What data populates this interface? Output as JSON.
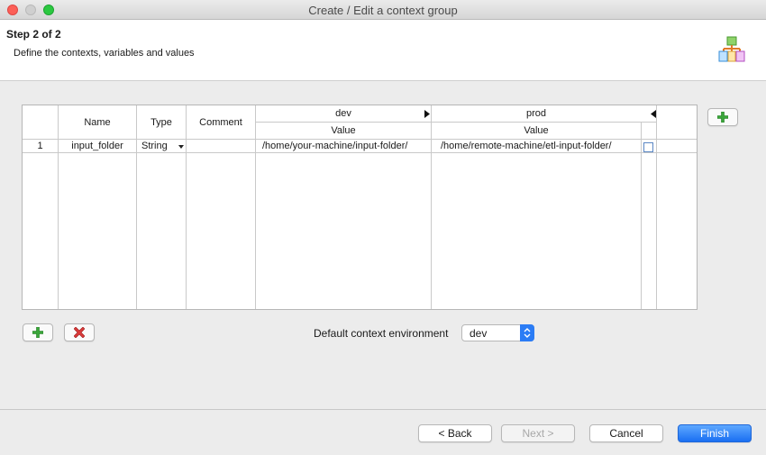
{
  "window": {
    "title": "Create / Edit a context group"
  },
  "header": {
    "step": "Step 2 of 2",
    "description": "Define the contexts, variables and values",
    "icon": "context-group-wizard-icon"
  },
  "table": {
    "columns": {
      "name": "Name",
      "type": "Type",
      "comment": "Comment"
    },
    "contexts": [
      {
        "name": "dev",
        "value_header": "Value"
      },
      {
        "name": "prod",
        "value_header": "Value"
      }
    ],
    "rows": [
      {
        "index": "1",
        "name": "input_folder",
        "type": "String",
        "comment": "",
        "dev_value": "/home/your-machine/input-folder/",
        "prod_value": "/home/remote-machine/etl-input-folder/",
        "prompt_checked": false
      }
    ]
  },
  "buttons": {
    "add_context_icon": "plus-icon",
    "add_variable_icon": "plus-icon",
    "remove_variable_icon": "delete-x-icon",
    "back": "< Back",
    "next": "Next >",
    "cancel": "Cancel",
    "finish": "Finish"
  },
  "default_context": {
    "label": "Default context environment",
    "selected": "dev"
  },
  "colors": {
    "accent": "#1a6ff2",
    "plus_green": "#3aa53a",
    "delete_red": "#d93a3a"
  }
}
